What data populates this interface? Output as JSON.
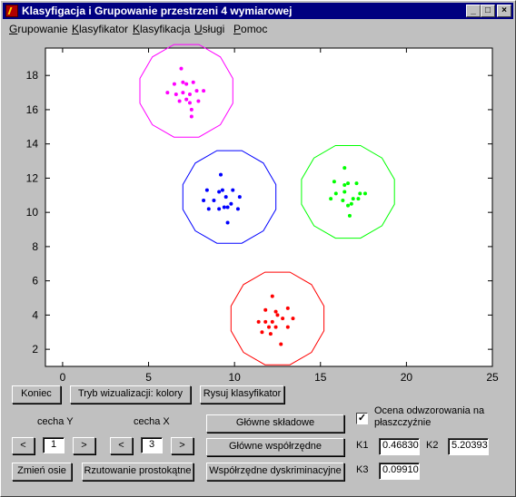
{
  "window": {
    "title": "Klasyfigacja i Grupowanie przestrzeni 4 wymiarowej",
    "controls": {
      "minimize": "_",
      "maximize": "□",
      "close": "×"
    }
  },
  "menu": [
    {
      "label": "Grupowanie",
      "key": "G",
      "rest": "rupowanie"
    },
    {
      "label": "Klasyfikator",
      "key": "K",
      "rest": "lasyfikator"
    },
    {
      "label": "Klasyfikacja",
      "key": "K",
      "rest": "lasyfikacja"
    },
    {
      "label": "Usługi",
      "key": "U",
      "rest": "sługi"
    },
    {
      "label": "Pomoc",
      "key": "P",
      "rest": "omoc"
    }
  ],
  "chart_data": {
    "type": "scatter",
    "xlim": [
      -1,
      25
    ],
    "ylim": [
      1,
      19.6
    ],
    "xticks": [
      0,
      5,
      10,
      15,
      20,
      25
    ],
    "yticks": [
      2,
      4,
      6,
      8,
      10,
      12,
      14,
      16,
      18
    ],
    "grid": false,
    "clusters": [
      {
        "color": "#ff00ff",
        "center": [
          7.2,
          17.1
        ],
        "radius": 2.8,
        "points": [
          [
            6.9,
            18.4
          ],
          [
            6.1,
            17.0
          ],
          [
            6.5,
            17.5
          ],
          [
            6.6,
            16.9
          ],
          [
            7.0,
            17.6
          ],
          [
            7.2,
            17.5
          ],
          [
            7.6,
            17.6
          ],
          [
            7.8,
            17.1
          ],
          [
            8.2,
            17.1
          ],
          [
            7.4,
            16.9
          ],
          [
            6.8,
            16.5
          ],
          [
            7.4,
            16.4
          ],
          [
            7.2,
            16.6
          ],
          [
            7.9,
            16.5
          ],
          [
            7.5,
            16.0
          ],
          [
            7.5,
            15.6
          ],
          [
            7.0,
            17.0
          ]
        ]
      },
      {
        "color": "#0000ff",
        "center": [
          9.7,
          10.9
        ],
        "radius": 2.8,
        "points": [
          [
            9.2,
            12.2
          ],
          [
            8.4,
            11.3
          ],
          [
            9.3,
            11.3
          ],
          [
            9.1,
            11.2
          ],
          [
            9.9,
            11.3
          ],
          [
            8.2,
            10.7
          ],
          [
            8.8,
            10.7
          ],
          [
            9.5,
            10.9
          ],
          [
            10.3,
            10.9
          ],
          [
            9.8,
            10.5
          ],
          [
            9.6,
            10.3
          ],
          [
            9.4,
            10.3
          ],
          [
            8.5,
            10.2
          ],
          [
            10.2,
            10.2
          ],
          [
            9.6,
            9.4
          ],
          [
            9.1,
            10.2
          ]
        ]
      },
      {
        "color": "#00ff00",
        "center": [
          16.6,
          11.2
        ],
        "radius": 2.8,
        "points": [
          [
            16.4,
            12.6
          ],
          [
            15.8,
            11.8
          ],
          [
            16.4,
            11.6
          ],
          [
            16.6,
            11.7
          ],
          [
            17.1,
            11.7
          ],
          [
            15.9,
            11.1
          ],
          [
            16.4,
            11.2
          ],
          [
            17.3,
            11.1
          ],
          [
            17.6,
            11.1
          ],
          [
            15.6,
            10.8
          ],
          [
            16.3,
            10.7
          ],
          [
            16.9,
            10.8
          ],
          [
            17.2,
            10.8
          ],
          [
            16.6,
            10.4
          ],
          [
            16.8,
            10.5
          ],
          [
            16.7,
            9.8
          ]
        ]
      },
      {
        "color": "#ff0000",
        "center": [
          12.5,
          3.8
        ],
        "radius": 2.8,
        "points": [
          [
            12.2,
            5.1
          ],
          [
            11.8,
            4.3
          ],
          [
            12.4,
            4.2
          ],
          [
            13.1,
            4.4
          ],
          [
            12.5,
            4.0
          ],
          [
            11.4,
            3.6
          ],
          [
            11.8,
            3.6
          ],
          [
            12.2,
            3.6
          ],
          [
            12.8,
            3.8
          ],
          [
            13.4,
            3.8
          ],
          [
            12.0,
            3.3
          ],
          [
            12.4,
            3.3
          ],
          [
            13.1,
            3.3
          ],
          [
            11.6,
            3.0
          ],
          [
            12.1,
            2.9
          ],
          [
            12.7,
            2.3
          ]
        ]
      }
    ]
  },
  "buttons": {
    "koniec": "Koniec",
    "tryb": "Tryb wizualizacji: kolory",
    "rysuj": "Rysuj klasyfikator",
    "glowne_skladowe": "Główne składowe",
    "glowne_wspolrzedne": "Główne współrzędne",
    "wspolrzedne_dyskr": "Współrzędne dyskriminacyjne",
    "zmien_osie": "Zmień osie",
    "rzutowanie": "Rzutowanie prostokątne",
    "prev": "<",
    "next": ">"
  },
  "cecha_y": {
    "label": "cecha Y",
    "value": "1"
  },
  "cecha_x": {
    "label": "cecha X",
    "value": "3"
  },
  "ocena": {
    "label_line1": "Ocena odwzorowania na",
    "label_line2": "płaszczyźnie",
    "checked": "✓"
  },
  "k": {
    "k1_label": "K1",
    "k1_value": "0.46830",
    "k2_label": "K2",
    "k2_value": "5.20393",
    "k3_label": "K3",
    "k3_value": "0.09910"
  }
}
